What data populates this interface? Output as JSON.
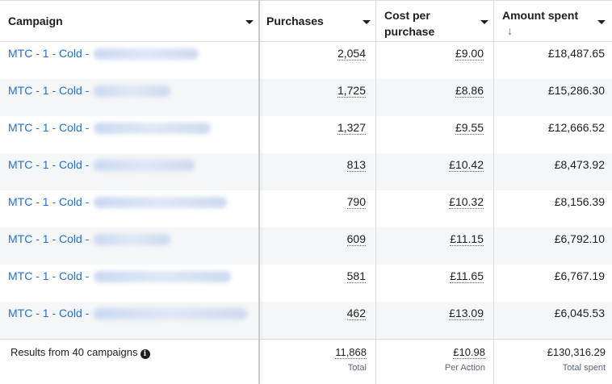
{
  "header": {
    "campaign": "Campaign",
    "purchases": "Purchases",
    "cost_per_purchase_line1": "Cost per",
    "cost_per_purchase_line2": "purchase",
    "amount_spent": "Amount spent",
    "sort_arrow": "↓"
  },
  "rows": [
    {
      "name": "MTC - 1 - Cold -",
      "purchases": "2,054",
      "cost": "£9.00",
      "amount": "£18,487.65"
    },
    {
      "name": "MTC - 1 - Cold -",
      "purchases": "1,725",
      "cost": "£8.86",
      "amount": "£15,286.30"
    },
    {
      "name": "MTC - 1 - Cold -",
      "purchases": "1,327",
      "cost": "£9.55",
      "amount": "£12,666.52"
    },
    {
      "name": "MTC - 1 - Cold -",
      "purchases": "813",
      "cost": "£10.42",
      "amount": "£8,473.92"
    },
    {
      "name": "MTC - 1 - Cold -",
      "purchases": "790",
      "cost": "£10.32",
      "amount": "£8,156.39"
    },
    {
      "name": "MTC - 1 - Cold -",
      "purchases": "609",
      "cost": "£11.15",
      "amount": "£6,792.10"
    },
    {
      "name": "MTC - 1 - Cold -",
      "purchases": "581",
      "cost": "£11.65",
      "amount": "£6,767.19"
    },
    {
      "name": "MTC - 1 - Cold -",
      "purchases": "462",
      "cost": "£13.09",
      "amount": "£6,045.53"
    }
  ],
  "footer": {
    "results_label": "Results from 40 campaigns",
    "info_icon": "i",
    "purchases_total": "11,868",
    "purchases_sub": "Total",
    "cost_total": "£10.98",
    "cost_sub": "Per Action",
    "amount_total": "£130,316.29",
    "amount_sub": "Total spent"
  }
}
